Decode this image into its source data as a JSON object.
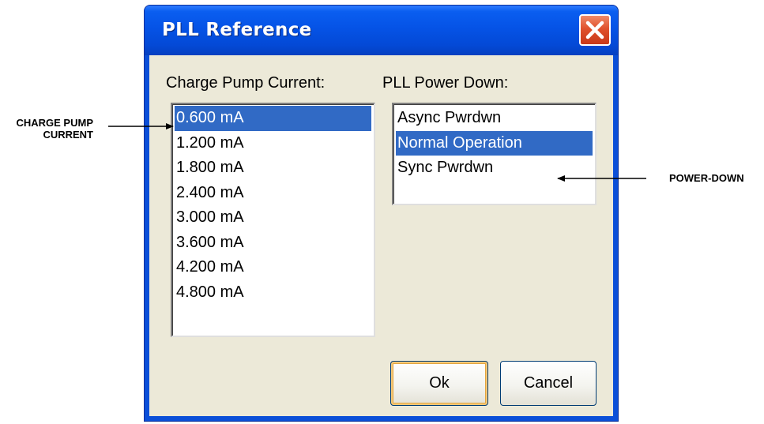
{
  "dialog": {
    "title": "PLL Reference",
    "close_icon": "close-x-icon",
    "accent_color": "#316ac5"
  },
  "charge_pump": {
    "label": "Charge Pump Current:",
    "items": [
      "0.600 mA",
      "1.200 mA",
      "1.800 mA",
      "2.400 mA",
      "3.000 mA",
      "3.600 mA",
      "4.200 mA",
      "4.800 mA"
    ],
    "selected_index": 0
  },
  "power_down": {
    "label": "PLL Power Down:",
    "items": [
      "Async Pwrdwn",
      "Normal Operation",
      "Sync Pwrdwn"
    ],
    "selected_index": 1
  },
  "buttons": {
    "ok": "Ok",
    "cancel": "Cancel"
  },
  "annotations": {
    "charge_pump_line1": "CHARGE PUMP",
    "charge_pump_line2": "CURRENT",
    "power_down": "POWER-DOWN"
  }
}
